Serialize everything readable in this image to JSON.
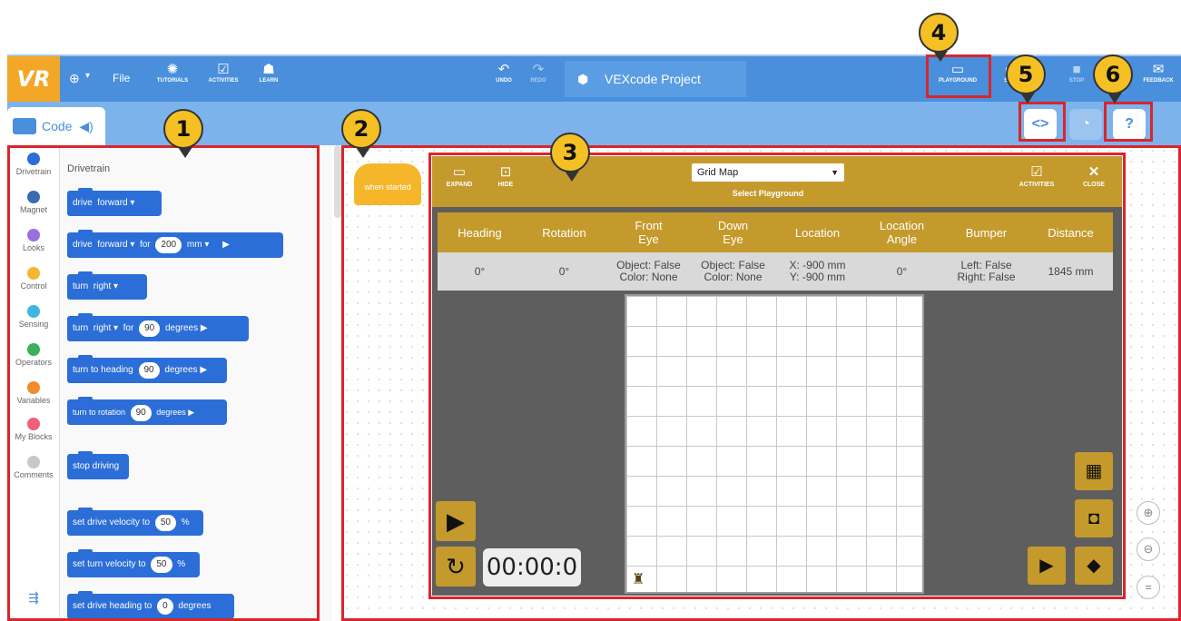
{
  "topbar": {
    "logo": "VR",
    "globe_chevron": "▾",
    "file": "File",
    "tutorials": "TUTORIALS",
    "activities": "ACTIVITIES",
    "learn": "LEARN",
    "undo": "UNDO",
    "redo": "REDO",
    "project_title": "VEXcode Project",
    "playground": "PLAYGROUND",
    "step": "STEP",
    "stop": "STOP",
    "feedback": "FEEDBACK"
  },
  "subbar": {
    "code_tab": "Code"
  },
  "categories": [
    {
      "label": "Drivetrain",
      "color": "#2b6ed8"
    },
    {
      "label": "Magnet",
      "color": "#3a6bb0"
    },
    {
      "label": "Looks",
      "color": "#9b6ee0"
    },
    {
      "label": "Control",
      "color": "#f4b632"
    },
    {
      "label": "Sensing",
      "color": "#3fb6e0"
    },
    {
      "label": "Operators",
      "color": "#3cb05a"
    },
    {
      "label": "Variables",
      "color": "#f08c2c"
    },
    {
      "label": "My Blocks",
      "color": "#f0607a"
    },
    {
      "label": "Comments",
      "color": "#c8c8c8"
    }
  ],
  "palette": {
    "title": "Drivetrain",
    "blocks": {
      "drive": {
        "verb": "drive",
        "dir": "forward ▾"
      },
      "drive_for": {
        "verb": "drive",
        "dir": "forward ▾",
        "for": "for",
        "value": "200",
        "unit": "mm ▾",
        "run": "▶"
      },
      "turn": {
        "verb": "turn",
        "dir": "right ▾"
      },
      "turn_for": {
        "verb": "turn",
        "dir": "right ▾",
        "for": "for",
        "value": "90",
        "unit": "degrees ▶"
      },
      "turn_heading": {
        "text": "turn to heading",
        "value": "90",
        "unit": "degrees ▶"
      },
      "turn_rotation": {
        "text": "turn to rotation",
        "value": "90",
        "unit": "degrees ▶"
      },
      "stop": {
        "text": "stop driving"
      },
      "drive_vel": {
        "text": "set drive velocity to",
        "value": "50",
        "unit": "%"
      },
      "turn_vel": {
        "text": "set turn velocity to",
        "value": "50",
        "unit": "%"
      },
      "drive_heading": {
        "text": "set drive heading to",
        "value": "0",
        "unit": "degrees"
      }
    }
  },
  "workspace": {
    "hat_block": "when started"
  },
  "playground": {
    "expand": "EXPAND",
    "hide": "HIDE",
    "map_value": "Grid Map",
    "select_label": "Select Playground",
    "activities": "ACTIVITIES",
    "close": "CLOSE",
    "sensor_headers": [
      "Heading",
      "Rotation",
      "Front\nEye",
      "Down\nEye",
      "Location",
      "Location\nAngle",
      "Bumper",
      "Distance"
    ],
    "sensor_values": [
      "0°",
      "0°",
      "Object: False\nColor: None",
      "Object: False\nColor: None",
      "X: -900 mm\nY: -900 mm",
      "0°",
      "Left: False\nRight: False",
      "1845 mm"
    ],
    "timer": "00:00:0"
  },
  "callouts": [
    "1",
    "2",
    "3",
    "4",
    "5",
    "6"
  ],
  "colors": {
    "accent": "#4a8fdc",
    "playground": "#c49a2c",
    "highlight": "#d9262c",
    "badge": "#f5c024"
  }
}
